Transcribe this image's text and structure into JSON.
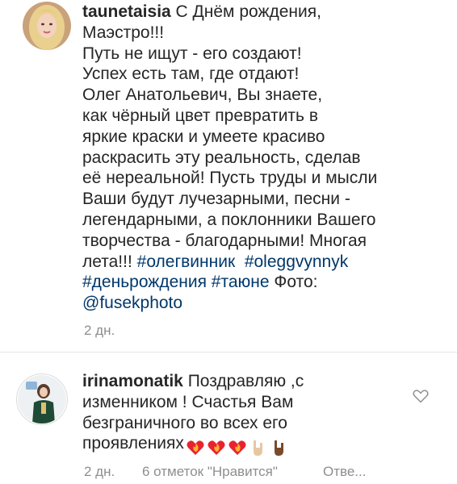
{
  "comments": [
    {
      "username": "taunetaisia",
      "text": " С Днём рождения,\nМаэстро!!!\nПуть не ищут - его создают!\nУспех есть там, где отдают!\nОлег Анатольевич, Вы знаете,\nкак чёрный цвет превратить в\nяркие краски и умеете красиво\nраскрасить эту реальность, сделав\nеё нереальной! Пусть труды и мысли\nВаши будут лучезарными, песни -\nлегендарными, а поклонники Вашего\nтворчества - благодарными! Многая\nлета!!! ",
      "tags": [
        "#олегвинник",
        "#oleggvynnyk",
        "#деньрождения",
        "#таюне"
      ],
      "photo_label": " Фото:",
      "mention": "@fusekphoto",
      "time": "2 дн."
    },
    {
      "username": "irinamonatik",
      "text": " Поздравляю ,с\nизменником ! Счастья Вам\nбезграничного во всех его\nпроявлениях",
      "emojis": [
        "heart-fire-emoji",
        "heart-fire-emoji",
        "heart-fire-emoji",
        "rock-hand-emoji",
        "rock-hand-emoji"
      ],
      "time": "2 дн.",
      "likes": "6 отметок \"Нравится\"",
      "reply": "Отве..."
    }
  ],
  "icons": {
    "like": "heart-outline-icon"
  },
  "colors": {
    "text": "#262626",
    "meta": "#8e8e8e",
    "link": "#00376b"
  }
}
